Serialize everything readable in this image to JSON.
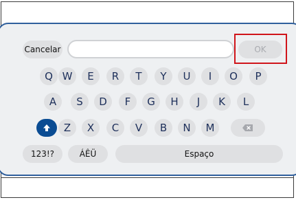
{
  "toolbar": {
    "cancel_label": "Cancelar",
    "text_value": "",
    "ok_label": "OK"
  },
  "rows": {
    "row1": [
      "Q",
      "W",
      "E",
      "R",
      "T",
      "Y",
      "U",
      "I",
      "O",
      "P"
    ],
    "row2": [
      "A",
      "S",
      "D",
      "F",
      "G",
      "H",
      "J",
      "K",
      "L"
    ],
    "row3": [
      "Z",
      "X",
      "C",
      "V",
      "B",
      "N",
      "M"
    ]
  },
  "bottom": {
    "numsym_label": "123!?",
    "accents_label": "ÁÊÜ",
    "space_label": "Espaço"
  },
  "colors": {
    "accent": "#0a4c93",
    "highlight": "#d0141a",
    "panel_border": "#2f5f9c"
  },
  "icons": {
    "shift": "shift-arrow-icon",
    "backspace": "backspace-icon"
  }
}
